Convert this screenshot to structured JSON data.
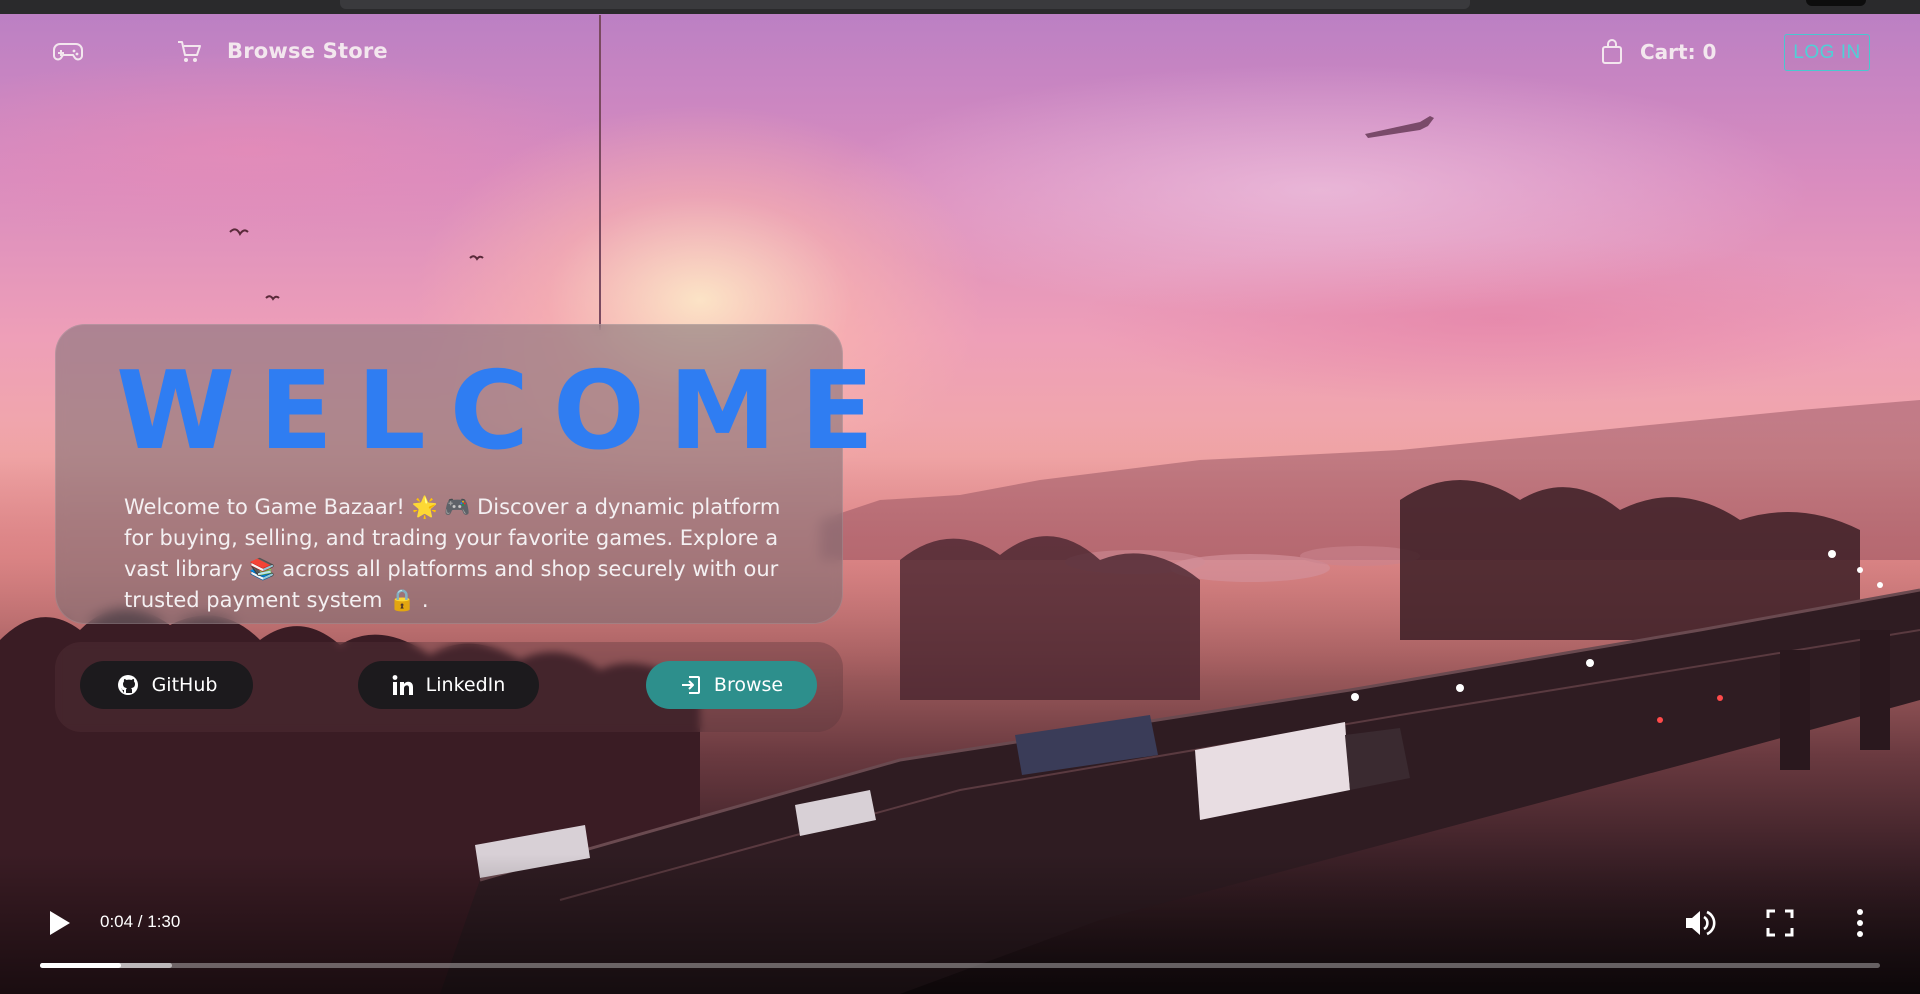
{
  "nav": {
    "home_icon": "gamepad-icon",
    "browse_icon": "cart-icon",
    "browse_label": "Browse Store",
    "cart_icon": "shopping-bag-icon",
    "cart_label": "Cart: 0",
    "login_label": "LOG IN"
  },
  "hero": {
    "title": "WELCOME",
    "description": "Welcome to Game Bazaar! 🌟 🎮 Discover a dynamic platform for buying, selling, and trading your favorite games. Explore a vast library 📚 across all platforms and shop securely with our trusted payment system 🔒 .",
    "buttons": [
      {
        "label": "GitHub",
        "icon": "github-icon"
      },
      {
        "label": "LinkedIn",
        "icon": "linkedin-icon"
      },
      {
        "label": "Browse",
        "icon": "sign-in-icon"
      }
    ]
  },
  "video": {
    "time": "0:04 / 1:30",
    "progress": 0.044,
    "buffered": 0.072,
    "play_icon": "play-icon",
    "volume_icon": "volume-icon",
    "fullscreen_icon": "fullscreen-icon",
    "more_icon": "more-vertical-icon"
  },
  "colors": {
    "title_blue": "#2f7df2",
    "login_teal": "#4fd0d6",
    "browse_teal": "#2d8f8c",
    "dark_button": "#1c1a1d"
  }
}
